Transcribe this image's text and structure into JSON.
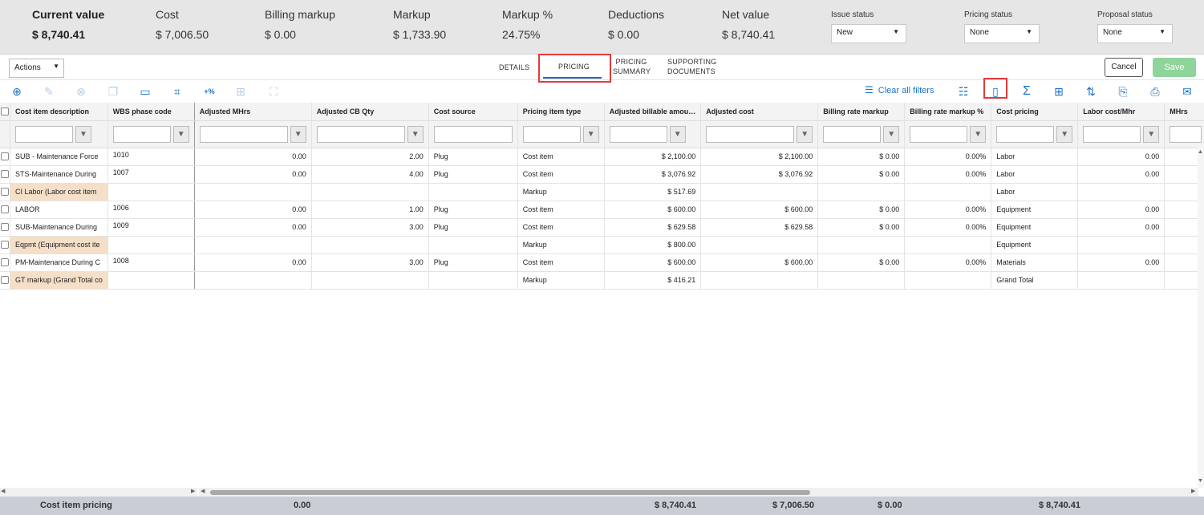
{
  "summary": {
    "current_value": {
      "label": "Current value",
      "value": "$ 8,740.41"
    },
    "cost": {
      "label": "Cost",
      "value": "$ 7,006.50"
    },
    "billing_markup": {
      "label": "Billing markup",
      "value": "$ 0.00"
    },
    "markup": {
      "label": "Markup",
      "value": "$ 1,733.90"
    },
    "markup_pct": {
      "label": "Markup %",
      "value": "24.75%"
    },
    "deductions": {
      "label": "Deductions",
      "value": "$ 0.00"
    },
    "net_value": {
      "label": "Net value",
      "value": "$ 8,740.41"
    },
    "issue_status": {
      "label": "Issue status",
      "value": "New"
    },
    "pricing_status": {
      "label": "Pricing status",
      "value": "None"
    },
    "proposal_status": {
      "label": "Proposal status",
      "value": "None"
    }
  },
  "tabbar": {
    "actions_label": "Actions",
    "tabs": [
      {
        "label": "DETAILS"
      },
      {
        "label": "PRICING"
      },
      {
        "line1": "PRICING",
        "line2": "SUMMARY"
      },
      {
        "line1": "SUPPORTING",
        "line2": "DOCUMENTS"
      }
    ],
    "cancel_label": "Cancel",
    "save_label": "Save"
  },
  "toolbar": {
    "clear_filters_label": "Clear all filters",
    "icons": [
      "add-icon",
      "edit-icon",
      "delete-icon",
      "copy-icon",
      "card-icon",
      "hierarchy-icon",
      "percent-add-icon",
      "group-icon",
      "expand-icon",
      "list-icon",
      "freeze-columns-icon",
      "sum-icon",
      "add-document-icon",
      "row-height-icon",
      "export-icon",
      "import-icon",
      "comment-icon"
    ]
  },
  "grid": {
    "columns": [
      "Cost item description",
      "WBS phase code",
      "Adjusted MHrs",
      "Adjusted CB Qty",
      "Cost source",
      "Pricing item type",
      "Adjusted billable amou…",
      "Adjusted cost",
      "Billing rate markup",
      "Billing rate markup %",
      "Cost pricing",
      "Labor cost/Mhr",
      "MHrs"
    ],
    "rows": [
      {
        "desc": "SUB - Maintenance Force",
        "wbs": "1010",
        "mhrs": "0.00",
        "cbqty": "2.00",
        "source": "Plug",
        "type": "Cost item",
        "billable": "$ 2,100.00",
        "cost": "$ 2,100.00",
        "brm": "$ 0.00",
        "brmp": "0.00%",
        "pricing": "Labor",
        "labor": "0.00",
        "tan": false
      },
      {
        "desc": "STS-Maintenance During",
        "wbs": "1007",
        "mhrs": "0.00",
        "cbqty": "4.00",
        "source": "Plug",
        "type": "Cost item",
        "billable": "$ 3,076.92",
        "cost": "$ 3,076.92",
        "brm": "$ 0.00",
        "brmp": "0.00%",
        "pricing": "Labor",
        "labor": "0.00",
        "tan": false
      },
      {
        "desc": "CI Labor (Labor cost item",
        "wbs": "",
        "mhrs": "",
        "cbqty": "",
        "source": "",
        "type": "Markup",
        "billable": "$ 517.69",
        "cost": "",
        "brm": "",
        "brmp": "",
        "pricing": "Labor",
        "labor": "",
        "tan": true
      },
      {
        "desc": "LABOR",
        "wbs": "1006",
        "mhrs": "0.00",
        "cbqty": "1.00",
        "source": "Plug",
        "type": "Cost item",
        "billable": "$ 600.00",
        "cost": "$ 600.00",
        "brm": "$ 0.00",
        "brmp": "0.00%",
        "pricing": "Equipment",
        "labor": "0.00",
        "tan": false
      },
      {
        "desc": "SUB-Maintenance During",
        "wbs": "1009",
        "mhrs": "0.00",
        "cbqty": "3.00",
        "source": "Plug",
        "type": "Cost item",
        "billable": "$ 629.58",
        "cost": "$ 629.58",
        "brm": "$ 0.00",
        "brmp": "0.00%",
        "pricing": "Equipment",
        "labor": "0.00",
        "tan": false
      },
      {
        "desc": "Eqpmt (Equipment cost ite",
        "wbs": "",
        "mhrs": "",
        "cbqty": "",
        "source": "",
        "type": "Markup",
        "billable": "$ 800.00",
        "cost": "",
        "brm": "",
        "brmp": "",
        "pricing": "Equipment",
        "labor": "",
        "tan": true
      },
      {
        "desc": "PM-Maintenance During C",
        "wbs": "1008",
        "mhrs": "0.00",
        "cbqty": "3.00",
        "source": "Plug",
        "type": "Cost item",
        "billable": "$ 600.00",
        "cost": "$ 600.00",
        "brm": "$ 0.00",
        "brmp": "0.00%",
        "pricing": "Materials",
        "labor": "0.00",
        "tan": false
      },
      {
        "desc": "GT markup (Grand Total co",
        "wbs": "",
        "mhrs": "",
        "cbqty": "",
        "source": "",
        "type": "Markup",
        "billable": "$ 416.21",
        "cost": "",
        "brm": "",
        "brmp": "",
        "pricing": "Grand Total",
        "labor": "",
        "tan": true
      }
    ]
  },
  "footer": {
    "label": "Cost item pricing",
    "mhrs": "0.00",
    "billable": "$ 8,740.41",
    "cost": "$ 7,006.50",
    "brm": "$ 0.00",
    "pricing": "$ 8,740.41"
  }
}
